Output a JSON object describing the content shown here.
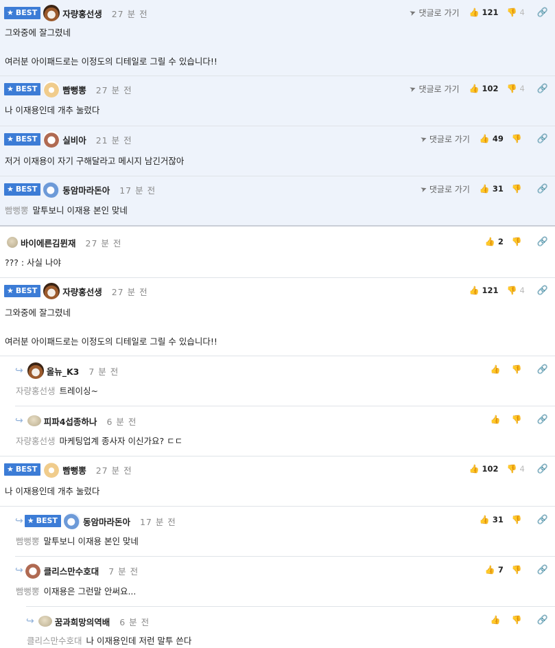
{
  "ui": {
    "best_label": "BEST",
    "goto_label": "댓글로 가기",
    "unit_time": "분 전"
  },
  "comments": [
    {
      "nick": "자량홍선생",
      "time": "27 분 전",
      "line1": "그와중에 잘그렸네",
      "line2": "여러분 아이패드로는 이정도의 디테일로 그릴 수 있습니다!!",
      "up": "121",
      "down": "4"
    },
    {
      "nick": "빰뻥뽕",
      "time": "27 분 전",
      "line1": "나 이재용인데 개추 눌렀다",
      "up": "102",
      "down": "4"
    },
    {
      "nick": "실비아",
      "time": "21 분 전",
      "line1": "저거 이재용이 자기 구해달라고 메시지 남긴거잖아",
      "up": "49",
      "down": ""
    },
    {
      "nick": "동암마라돈아",
      "time": "17 분 전",
      "ref": "빰뻥뽕",
      "line1": "말투보니 이재용 본인 맞네",
      "up": "31",
      "down": ""
    },
    {
      "nick": "바이에른김뮌재",
      "time": "27 분 전",
      "line1": "??? : 사실 나야",
      "up": "2",
      "down": ""
    },
    {
      "nick": "자량홍선생",
      "time": "27 분 전",
      "line1": "그와중에 잘그렸네",
      "line2": "여러분 아이패드로는 이정도의 디테일로 그릴 수 있습니다!!",
      "up": "121",
      "down": "4"
    },
    {
      "nick": "올뉴_K3",
      "time": "7 분 전",
      "ref": "자량홍선생",
      "line1": "트레이싱~",
      "up": "",
      "down": ""
    },
    {
      "nick": "피파4섭종하나",
      "time": "6 분 전",
      "ref": "자량홍선생",
      "line1": "마케팅업계 종사자 이신가요? ㄷㄷ",
      "up": "",
      "down": ""
    },
    {
      "nick": "빰뻥뽕",
      "time": "27 분 전",
      "line1": "나 이재용인데 개추 눌렀다",
      "up": "102",
      "down": "4"
    },
    {
      "nick": "동암마라돈아",
      "time": "17 분 전",
      "ref": "빰뻥뽕",
      "line1": "말투보니 이재용 본인 맞네",
      "up": "31",
      "down": ""
    },
    {
      "nick": "클리스만수호대",
      "time": "7 분 전",
      "ref": "빰뻥뽕",
      "line1": "이재용은 그런말 안써요...",
      "up": "7",
      "down": ""
    },
    {
      "nick": "꿈과희망의역배",
      "time": "6 분 전",
      "ref": "클리스만수호대",
      "line1": "나 이재용인데 저런 말투 쓴다",
      "up": "",
      "down": ""
    }
  ],
  "colors": {
    "best_badge": "#3c7cd6",
    "best_bg": "#eef3fb"
  }
}
